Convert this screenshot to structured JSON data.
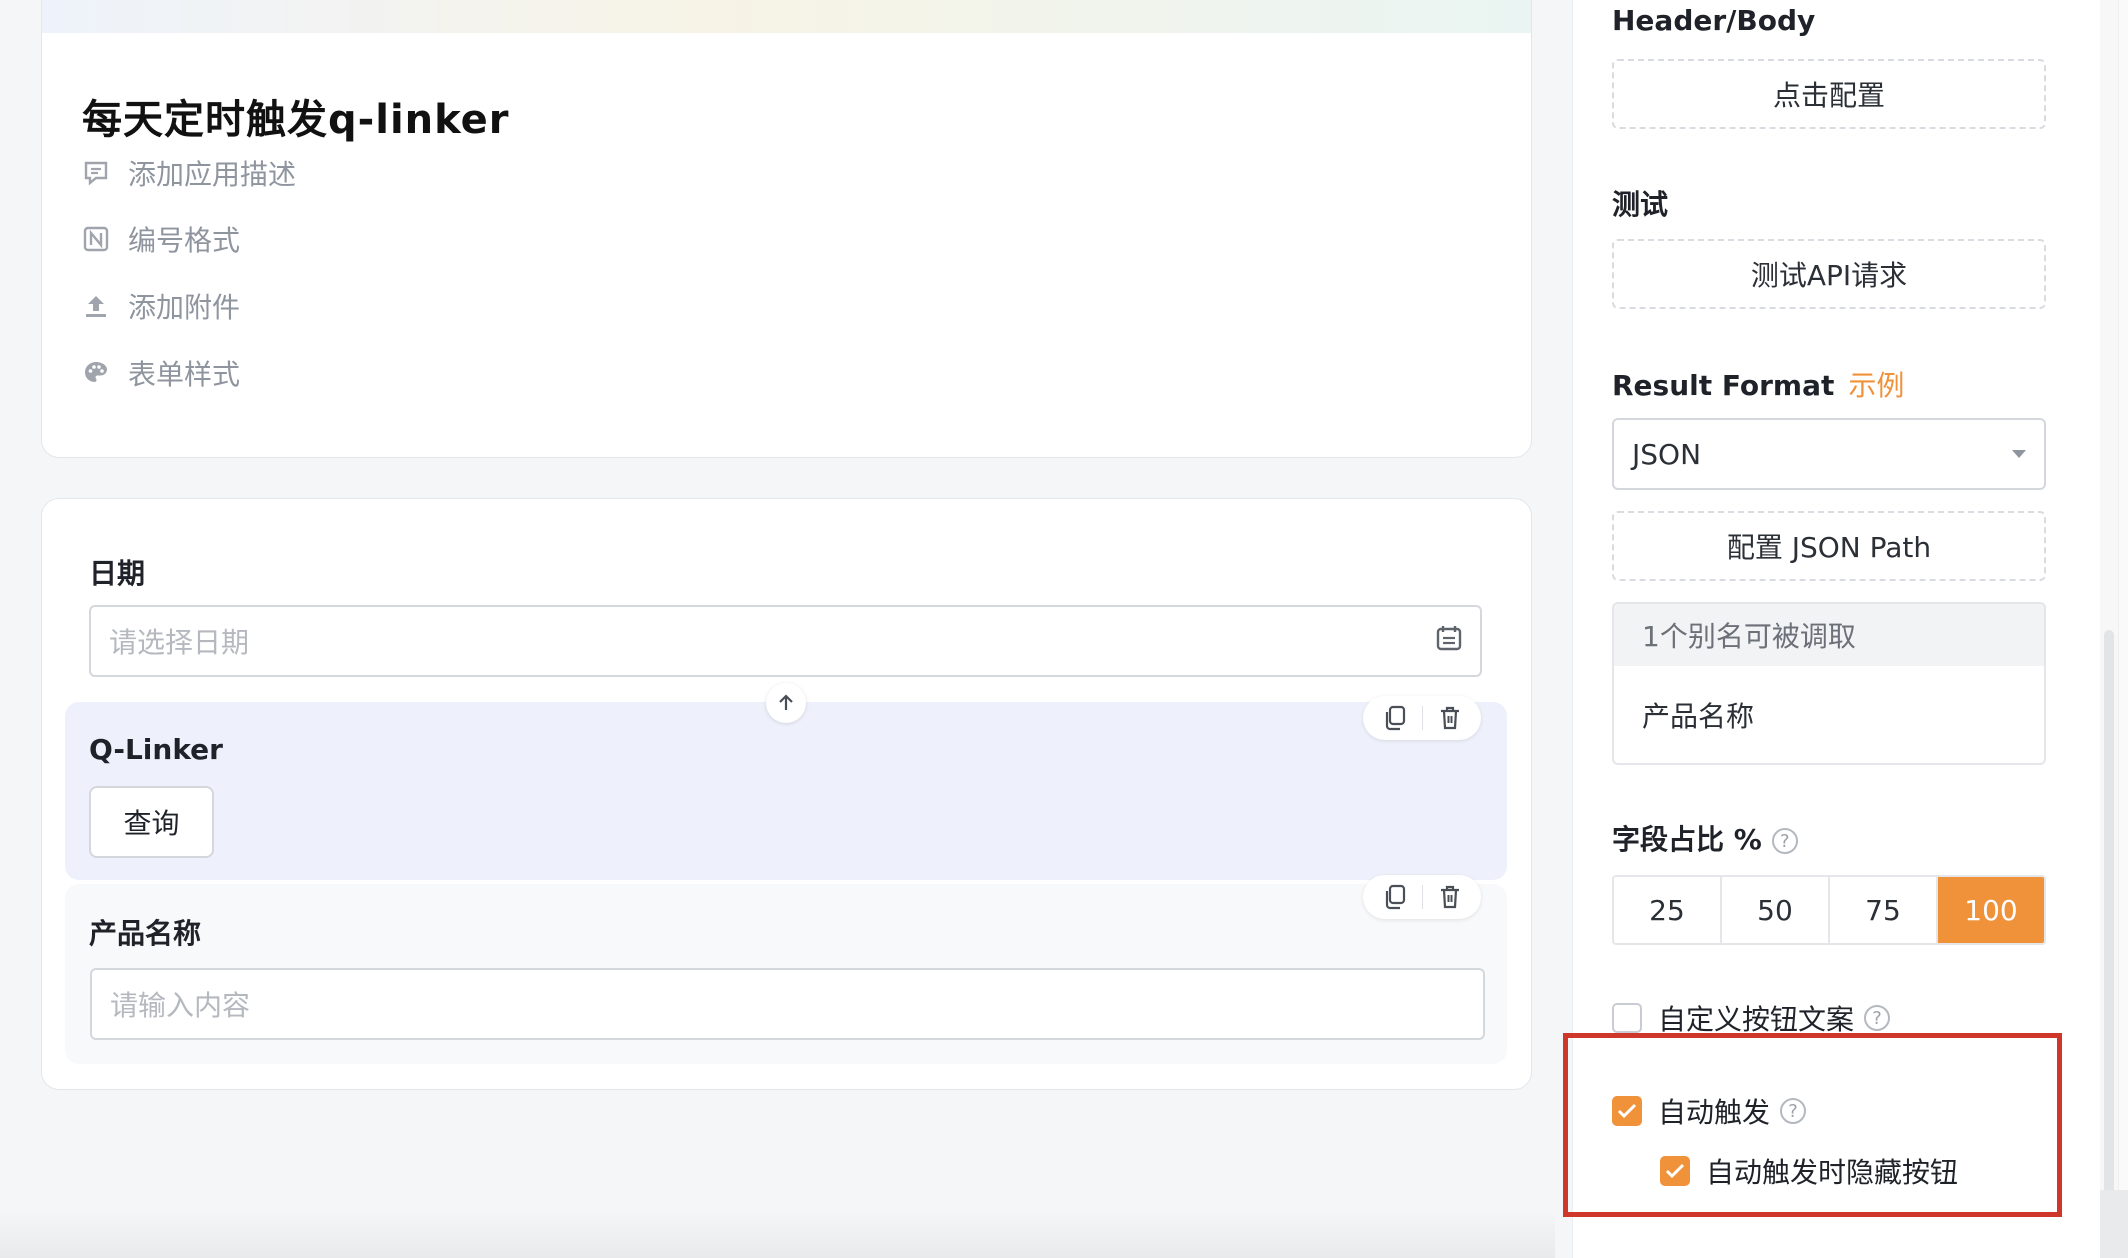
{
  "app": {
    "title": "每天定时触发q-linker",
    "meta_items": [
      {
        "icon": "comment-icon",
        "label": "添加应用描述"
      },
      {
        "icon": "number-format-icon",
        "label": "编号格式"
      },
      {
        "icon": "upload-icon",
        "label": "添加附件"
      },
      {
        "icon": "palette-icon",
        "label": "表单样式"
      }
    ]
  },
  "form": {
    "date_field": {
      "label": "日期",
      "placeholder": "请选择日期"
    },
    "qlinker_field": {
      "label": "Q-Linker",
      "button_label": "查询"
    },
    "product_field": {
      "label": "产品名称",
      "placeholder": "请输入内容"
    }
  },
  "panel": {
    "header_body": {
      "label": "Header/Body",
      "button": "点击配置"
    },
    "test": {
      "label": "测试",
      "button": "测试API请求"
    },
    "result_format": {
      "label": "Result Format",
      "example_link": "示例",
      "selected": "JSON",
      "json_path_button": "配置 JSON Path",
      "alias_header": "1个别名可被调取",
      "alias_items": [
        "产品名称"
      ]
    },
    "field_ratio": {
      "label": "字段占比 %",
      "options": [
        "25",
        "50",
        "75",
        "100"
      ],
      "selected": "100"
    },
    "checkboxes": {
      "custom_button_text": {
        "label": "自定义按钮文案",
        "checked": false
      },
      "auto_trigger": {
        "label": "自动触发",
        "checked": true
      },
      "hide_button_on_auto": {
        "label": "自动触发时隐藏按钮",
        "checked": true
      }
    }
  },
  "colors": {
    "accent": "#f0923a",
    "highlight_border": "#d0372b",
    "qlinker_block_bg": "#eef1fb"
  }
}
